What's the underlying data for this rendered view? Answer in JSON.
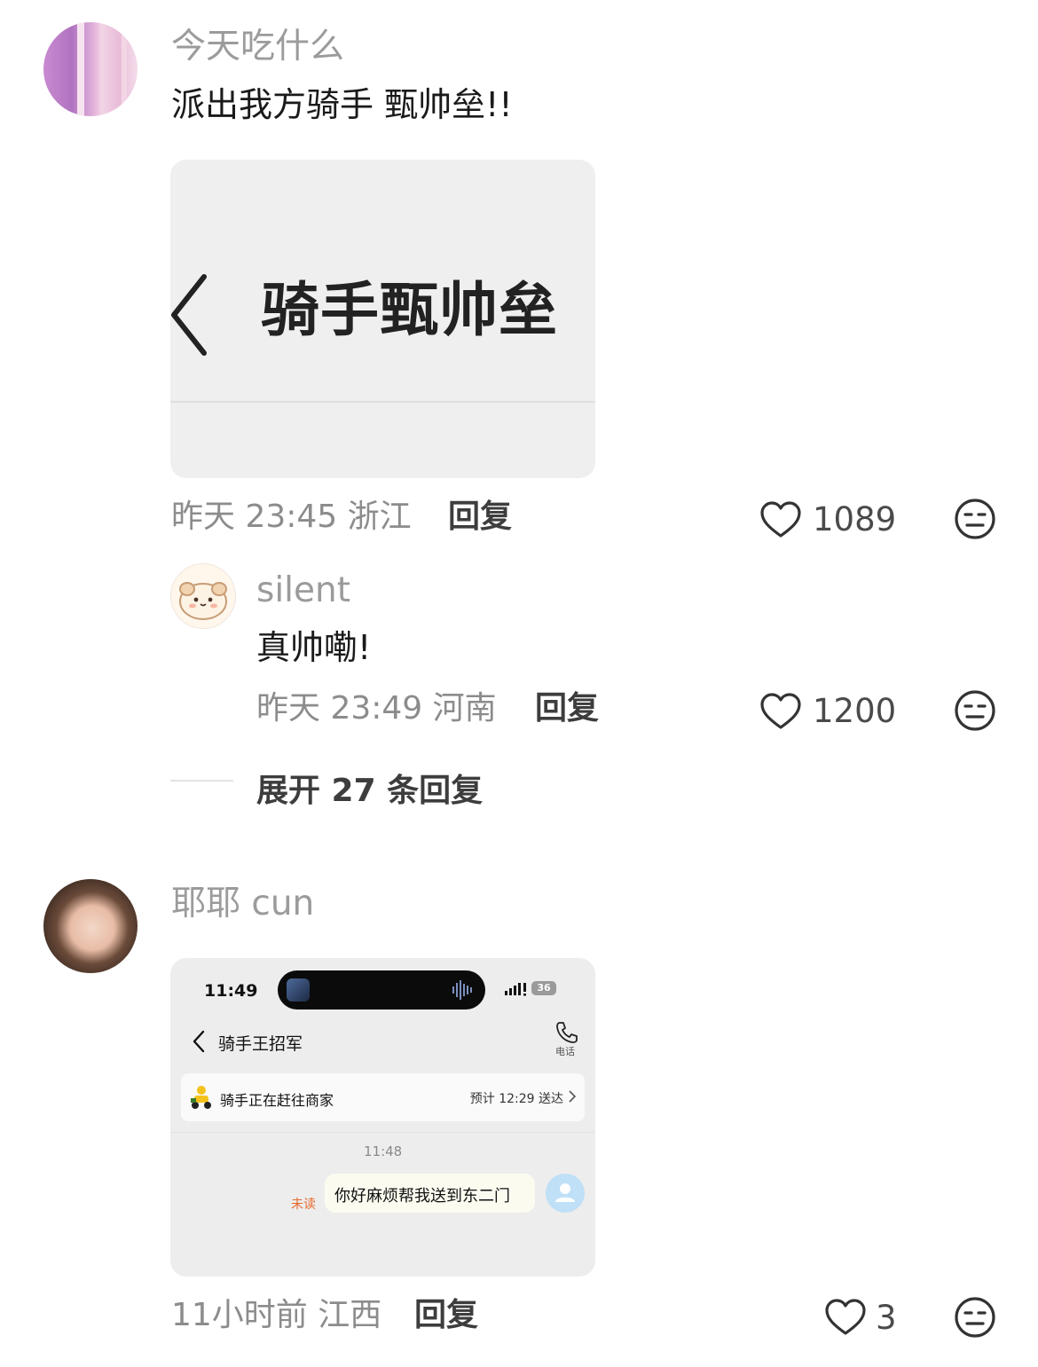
{
  "comments": [
    {
      "username": "今天吃什么",
      "text": "派出我方骑手 甄帅垒!!",
      "image": {
        "title": "骑手甄帅垒"
      },
      "time": "昨天 23:45",
      "location": "浙江",
      "reply_label": "回复",
      "likes": "1089",
      "replies": [
        {
          "username": "silent",
          "text": "真帅嘞!",
          "time": "昨天 23:49",
          "location": "河南",
          "reply_label": "回复",
          "likes": "1200"
        }
      ],
      "expand_label": "展开 27 条回复"
    },
    {
      "username": "耶耶 cun",
      "image": {
        "status_time": "11:49",
        "battery": "36",
        "chat_title": "骑手王招军",
        "call_label": "电话",
        "rider_status": "骑手正在赶往商家",
        "eta": "预计 12:29 送达",
        "message_time": "11:48",
        "unread_label": "未读",
        "message": "你好麻烦帮我送到东二门"
      },
      "time": "11小时前",
      "location": "江西",
      "reply_label": "回复",
      "likes": "3"
    }
  ],
  "icons": {
    "like": "heart-icon",
    "dislike": "expressionless-face-icon",
    "back": "chevron-left-icon",
    "call": "phone-icon"
  },
  "colors": {
    "username": "#9b9b9b",
    "meta": "#8c8c8c",
    "unread": "#e8692f"
  }
}
